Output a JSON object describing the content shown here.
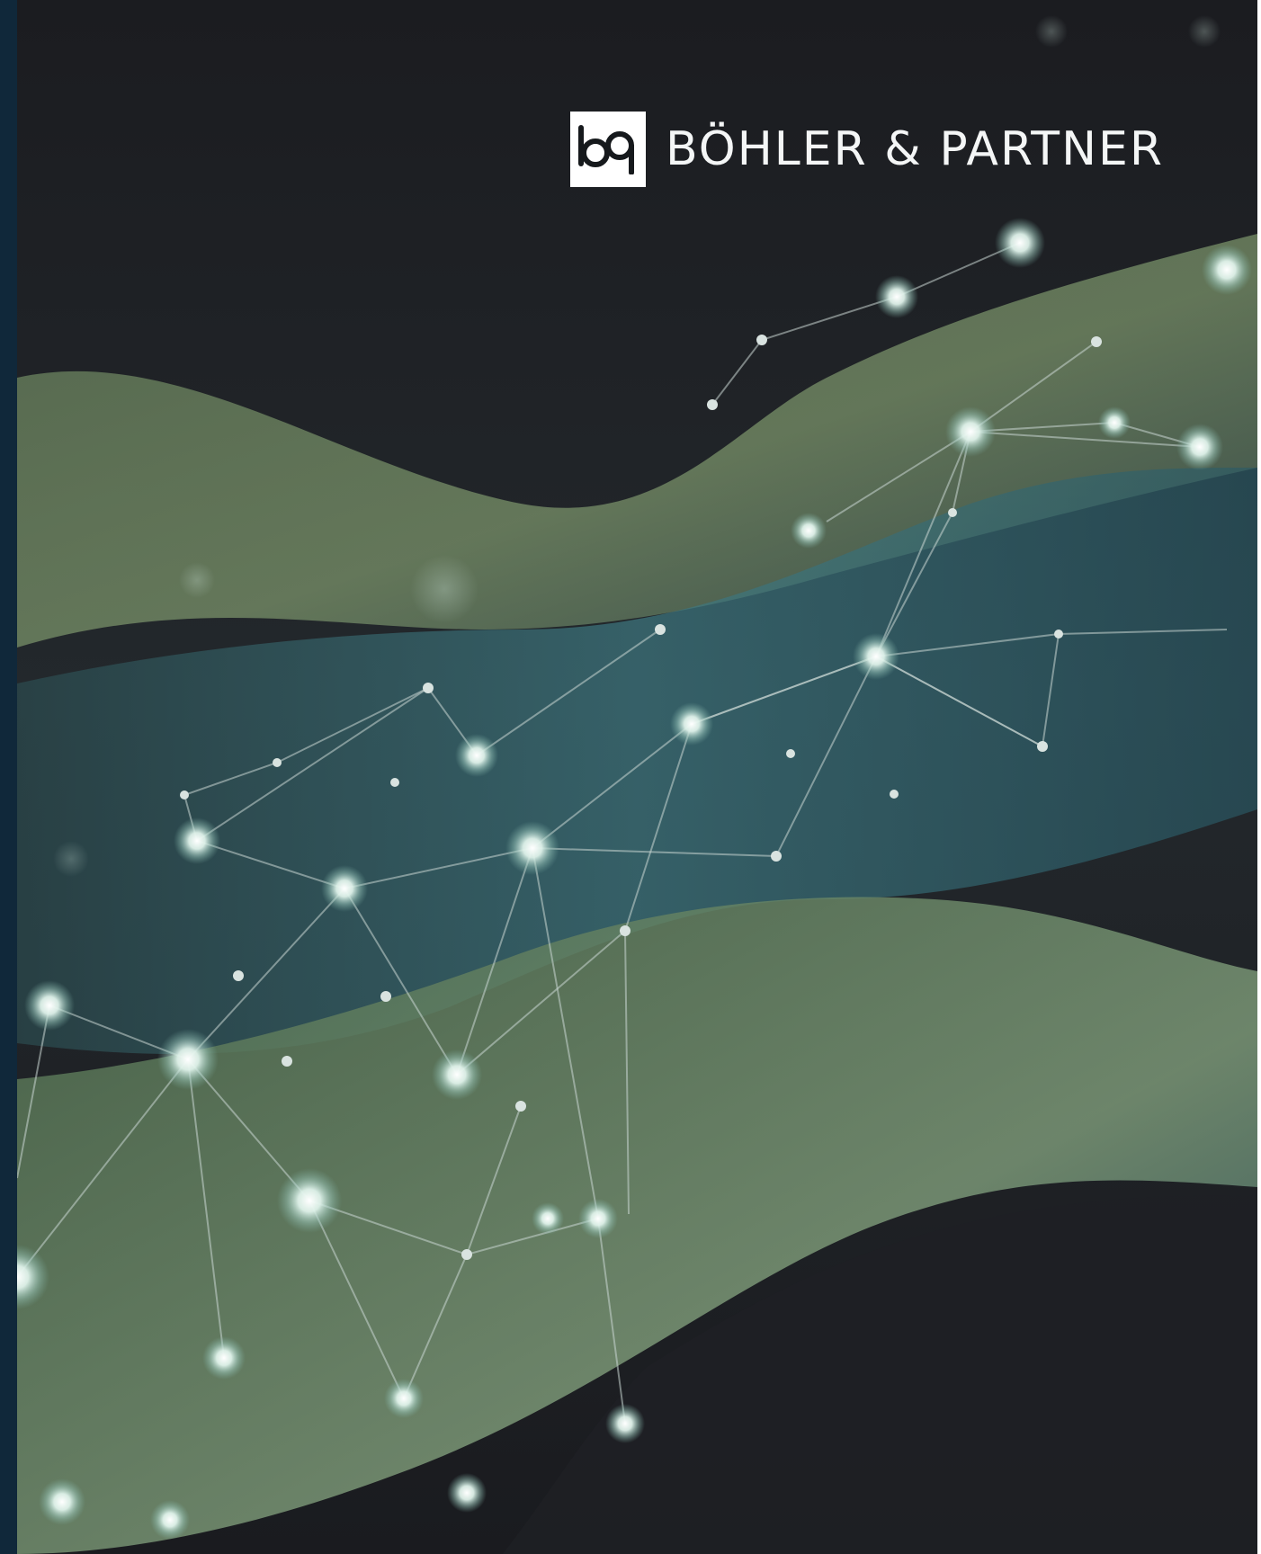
{
  "brand": {
    "logo_mark_text": "bp",
    "wordmark": "BÖHLER & PARTNER"
  },
  "colors": {
    "background": "#1b1d21",
    "left_edge": "#10283a",
    "wave_green": "#6f8a5e",
    "wave_teal": "#3e7a82",
    "node_glow": "#dff2ea"
  },
  "image": {
    "subject": "abstract network of glowing nodes connected by lines over flowing green and teal waves"
  }
}
